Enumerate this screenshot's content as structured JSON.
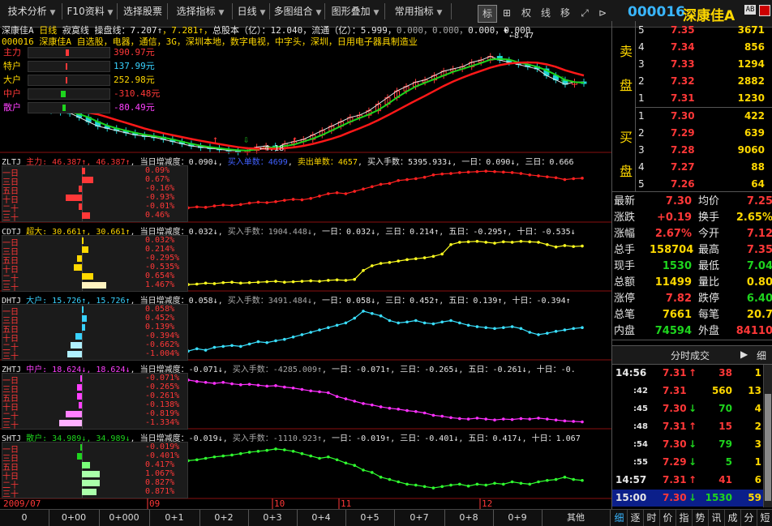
{
  "toolbar": {
    "buttons": [
      "技术分析",
      "F10资料",
      "选择股票",
      "选择指标",
      "日线",
      "多图组合",
      "图形叠加",
      "常用指标"
    ],
    "icons": [
      "标",
      "⊞",
      "权",
      "线",
      "移"
    ],
    "icon_names": [
      "mark-icon",
      "grid-icon",
      "rights-icon",
      "line-icon",
      "move-icon"
    ],
    "code": "000016",
    "name": "深康佳A"
  },
  "header": {
    "line1_parts": [
      "深康佳A",
      "日线",
      "寂寞线",
      "操盘线",
      "：7.207↑",
      "7.281↑",
      "总股本（亿）：12.040",
      "流通（亿）：5.999",
      "0.000",
      "0.000",
      "0.000",
      "0.000"
    ],
    "line2": "000016  深康佳A  自选股，电器，通信，3G，深圳本地，数字电视，中字头，深圳，日用电子器具制造业",
    "fund_rows": [
      {
        "label": "主力",
        "value": "390.97元"
      },
      {
        "label": "特户",
        "value": "137.99元"
      },
      {
        "label": "大户",
        "value": "252.98元"
      },
      {
        "label": "中户",
        "value": "-310.48元"
      },
      {
        "label": "散户",
        "value": "-80.49元"
      }
    ],
    "high_label": "8.47",
    "low_label": "4.18"
  },
  "sub_panels": [
    {
      "code": "ZLTJ",
      "name": "主力",
      "v1": "46.387↑",
      "v2": "46.387↑",
      "day": "当日增减度：0.090↓",
      "p1": "买入单数：4699",
      "p2": "卖出单数：4657",
      "p3": "买入手数：5395.933↓",
      "p4": "一日：0.090↓",
      "p5": "三日：0.666",
      "rows": [
        "0.09%",
        "0.67%",
        "-0.16%",
        "-0.93%",
        "-0.01%",
        "0.46%"
      ]
    },
    {
      "code": "CDTJ",
      "name": "超大",
      "v1": "30.661↑",
      "v2": "30.661↑",
      "day": "当日增减度：0.032↓",
      "p1": "买入手数：1904.448↓",
      "p2": "一日：0.032↓",
      "p3": "三日：0.214↑",
      "p4": "五日：-0.295↑",
      "p5": "十日：-0.535↓",
      "rows": [
        "0.032%",
        "0.214%",
        "-0.295%",
        "-0.535%",
        "0.654%",
        "1.467%"
      ]
    },
    {
      "code": "DHTJ",
      "name": "大户",
      "v1": "15.726↑",
      "v2": "15.726↑",
      "day": "当日增减度：0.058↓",
      "p1": "买入手数：3491.484↓",
      "p2": "一日：0.058↓",
      "p3": "三日：0.452↑",
      "p4": "五日：0.139↑",
      "p5": "十日：-0.394↑",
      "rows": [
        "0.058%",
        "0.452%",
        "0.139%",
        "-0.394%",
        "-0.662%",
        "-1.004%"
      ]
    },
    {
      "code": "ZHTJ",
      "name": "中户",
      "v1": "18.624↓",
      "v2": "18.624↓",
      "day": "当日增减度：-0.071↓",
      "p1": "买入手数：-4285.009↑",
      "p2": "一日：-0.071↑",
      "p3": "三日：-0.265↓",
      "p4": "五日：-0.261↓",
      "p5": "十日：-0.",
      "rows": [
        "-0.071%",
        "-0.265%",
        "-0.261%",
        "-0.138%",
        "-0.819%",
        "-1.334%"
      ]
    },
    {
      "code": "SHTJ",
      "name": "散户",
      "v1": "34.989↓",
      "v2": "34.989↓",
      "day": "当日增减度：-0.019↓",
      "p1": "买入手数：-1110.923↑",
      "p2": "一日：-0.019↑",
      "p3": "三日：-0.401↓",
      "p4": "五日：0.417↓",
      "p5": "十日：1.067",
      "rows": [
        "-0.019%",
        "-0.401%",
        "0.417%",
        "1.067%",
        "0.827%",
        "0.871%"
      ]
    }
  ],
  "row_labels": [
    "一日",
    "三日",
    "五日",
    "十日",
    "二十",
    "三十"
  ],
  "date_axis": [
    "2009/07",
    "09",
    "10",
    "11",
    "12"
  ],
  "order_book": {
    "sell_label": [
      "卖",
      "盘"
    ],
    "buy_label": [
      "买",
      "盘"
    ],
    "sells": [
      {
        "n": "5",
        "price": "7.35",
        "vol": "3671"
      },
      {
        "n": "4",
        "price": "7.34",
        "vol": "856"
      },
      {
        "n": "3",
        "price": "7.33",
        "vol": "1294"
      },
      {
        "n": "2",
        "price": "7.32",
        "vol": "2882"
      },
      {
        "n": "1",
        "price": "7.31",
        "vol": "1230"
      }
    ],
    "buys": [
      {
        "n": "1",
        "price": "7.30",
        "vol": "422"
      },
      {
        "n": "2",
        "price": "7.29",
        "vol": "639"
      },
      {
        "n": "3",
        "price": "7.28",
        "vol": "9060"
      },
      {
        "n": "4",
        "price": "7.27",
        "vol": "88"
      },
      {
        "n": "5",
        "price": "7.26",
        "vol": "64"
      }
    ]
  },
  "stats": [
    {
      "l1": "最新",
      "v1": "7.30",
      "l2": "均价",
      "v2": "7.25"
    },
    {
      "l1": "涨跌",
      "v1": "+0.19",
      "l2": "换手",
      "v2": "2.65%"
    },
    {
      "l1": "涨幅",
      "v1": "2.67%",
      "l2": "今开",
      "v2": "7.12"
    },
    {
      "l1": "总手",
      "v1": "158704",
      "l2": "最高",
      "v2": "7.35"
    },
    {
      "l1": "现手",
      "v1": "1530",
      "l2": "最低",
      "v2": "7.04"
    },
    {
      "l1": "总额",
      "v1": "11499",
      "l2": "量比",
      "v2": "0.80"
    },
    {
      "l1": "涨停",
      "v1": "7.82",
      "l2": "跌停",
      "v2": "6.40"
    },
    {
      "l1": "总笔",
      "v1": "7661",
      "l2": "每笔",
      "v2": "20.7"
    },
    {
      "l1": "内盘",
      "v1": "74594",
      "l2": "外盘",
      "v2": "84110"
    }
  ],
  "ticks_header": "分时成交",
  "ticks_tab": "细",
  "ticks": [
    {
      "t": "14:56",
      "p": "7.31",
      "d": "↑",
      "v": "38",
      "n": "1"
    },
    {
      "t": ":42",
      "p": "7.31",
      "d": "",
      "v": "560",
      "n": "13"
    },
    {
      "t": ":45",
      "p": "7.30",
      "d": "↓",
      "v": "70",
      "n": "4"
    },
    {
      "t": ":48",
      "p": "7.31",
      "d": "↑",
      "v": "15",
      "n": "2"
    },
    {
      "t": ":54",
      "p": "7.30",
      "d": "↓",
      "v": "79",
      "n": "3"
    },
    {
      "t": ":55",
      "p": "7.29",
      "d": "↓",
      "v": "5",
      "n": "1"
    },
    {
      "t": "14:57",
      "p": "7.31",
      "d": "↑",
      "v": "41",
      "n": "6"
    },
    {
      "t": "15:00",
      "p": "7.30",
      "d": "↓",
      "v": "1530",
      "n": "59"
    }
  ],
  "bottom_tabs": [
    "0",
    "0+00",
    "0+000",
    "0+1",
    "0+2",
    "0+3",
    "0+4",
    "0+5",
    "0+7",
    "0+8",
    "0+9",
    "其他"
  ],
  "right_tabs": [
    "细",
    "逐",
    "时",
    "价",
    "指",
    "势",
    "讯",
    "成",
    "分",
    "短"
  ],
  "chart_data": [
    {
      "type": "line",
      "name": "price",
      "series": [
        {
          "name": "close",
          "values": [
            6.2,
            6.15,
            6.0,
            5.95,
            5.9,
            5.7,
            5.5,
            5.3,
            5.2,
            5.1,
            5.0,
            4.9,
            4.85,
            4.8,
            4.7,
            4.6,
            4.5,
            4.4,
            4.35,
            4.3,
            4.25,
            4.2,
            4.18,
            4.2,
            4.35,
            4.4,
            4.3,
            4.5,
            4.6,
            4.7,
            4.9,
            5.1,
            5.3,
            5.5,
            5.7,
            5.8,
            6.0,
            6.3,
            6.6,
            6.9,
            7.1,
            7.3,
            7.4,
            7.6,
            7.8,
            7.9,
            8.0,
            8.2,
            8.3,
            8.47,
            8.3,
            8.2,
            8.1,
            8.0,
            7.9,
            7.6,
            7.4,
            7.2,
            7.31,
            7.3
          ]
        }
      ]
    },
    {
      "type": "line",
      "name": "ZLTJ",
      "values": [
        0.2,
        0.22,
        0.21,
        0.24,
        0.26,
        0.25,
        0.27,
        0.3,
        0.32,
        0.31,
        0.33,
        0.36,
        0.38,
        0.37,
        0.4,
        0.45,
        0.5,
        0.52,
        0.5,
        0.55,
        0.6,
        0.65,
        0.7,
        0.72,
        0.78,
        0.8,
        0.82,
        0.85,
        0.9,
        0.92,
        0.93,
        0.95,
        0.96,
        0.97,
        0.98,
        0.97,
        0.96,
        0.95,
        0.93,
        0.9,
        0.88,
        0.86,
        0.84,
        0.8,
        0.82,
        0.83
      ]
    },
    {
      "type": "line",
      "name": "CDTJ",
      "values": [
        0.05,
        0.06,
        0.08,
        0.07,
        0.09,
        0.1,
        0.08,
        0.09,
        0.1,
        0.11,
        0.12,
        0.1,
        0.11,
        0.12,
        0.13,
        0.12,
        0.14,
        0.15,
        0.14,
        0.16,
        0.35,
        0.45,
        0.5,
        0.52,
        0.55,
        0.58,
        0.6,
        0.62,
        0.65,
        0.7,
        0.9,
        0.95,
        0.96,
        0.97,
        0.95,
        0.93,
        0.96,
        0.95,
        0.97,
        0.96,
        0.95,
        0.9,
        0.85,
        0.88,
        0.86,
        0.87
      ]
    },
    {
      "type": "line",
      "name": "DHTJ",
      "values": [
        0.1,
        0.15,
        0.12,
        0.18,
        0.2,
        0.22,
        0.2,
        0.25,
        0.3,
        0.28,
        0.32,
        0.35,
        0.4,
        0.45,
        0.5,
        0.55,
        0.6,
        0.65,
        0.7,
        0.8,
        0.95,
        0.9,
        0.85,
        0.75,
        0.7,
        0.72,
        0.75,
        0.7,
        0.68,
        0.72,
        0.75,
        0.7,
        0.65,
        0.62,
        0.6,
        0.58,
        0.6,
        0.62,
        0.58,
        0.5,
        0.45,
        0.48,
        0.52,
        0.55,
        0.58,
        0.6
      ]
    },
    {
      "type": "line",
      "name": "ZHTJ",
      "values": [
        0.95,
        0.92,
        0.9,
        0.88,
        0.9,
        0.87,
        0.85,
        0.86,
        0.84,
        0.82,
        0.83,
        0.8,
        0.78,
        0.75,
        0.72,
        0.7,
        0.68,
        0.6,
        0.55,
        0.5,
        0.45,
        0.42,
        0.38,
        0.35,
        0.33,
        0.3,
        0.28,
        0.25,
        0.2,
        0.18,
        0.15,
        0.13,
        0.12,
        0.14,
        0.12,
        0.1,
        0.12,
        0.11,
        0.13,
        0.12,
        0.14,
        0.12,
        0.1,
        0.08,
        0.07,
        0.06
      ]
    },
    {
      "type": "line",
      "name": "SHTJ",
      "values": [
        0.7,
        0.72,
        0.75,
        0.78,
        0.8,
        0.82,
        0.85,
        0.88,
        0.9,
        0.92,
        0.95,
        0.93,
        0.9,
        0.85,
        0.8,
        0.75,
        0.78,
        0.72,
        0.65,
        0.6,
        0.5,
        0.45,
        0.35,
        0.3,
        0.25,
        0.2,
        0.18,
        0.15,
        0.12,
        0.15,
        0.18,
        0.2,
        0.16,
        0.2,
        0.18,
        0.22,
        0.2,
        0.25,
        0.22,
        0.2,
        0.25,
        0.28,
        0.3,
        0.35,
        0.3,
        0.28
      ]
    }
  ],
  "colors": {
    "up": "#ff3838",
    "down": "#1ed51e",
    "accent": "#ffd800",
    "blue": "#39b6ff"
  }
}
